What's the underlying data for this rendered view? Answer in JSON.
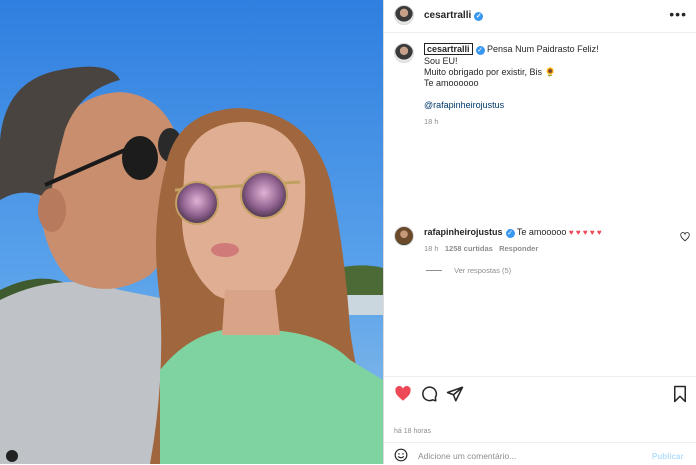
{
  "post": {
    "username": "cesartralli",
    "caption": {
      "first_line": "Pensa Num Paidrasto Feliz!",
      "line2": "Sou EU!",
      "line3": "Muito obrigado por existir, Bis",
      "line3_emoji": "🌻",
      "line4": "Te amoooooo",
      "mention": "@rafapinheirojustus",
      "time": "18 h"
    },
    "time_ago": "há 18 horas"
  },
  "comment": {
    "username": "rafapinheirojustus",
    "text": "Te amooooo",
    "hearts": "♥ ♥ ♥ ♥ ♥",
    "time": "18 h",
    "likes": "1258 curtidas",
    "reply": "Responder",
    "view_replies": "Ver respostas (5)"
  },
  "add_comment": {
    "placeholder": "Adicione um comentário...",
    "publish": "Publicar"
  },
  "colors": {
    "heart": "#ed4956",
    "verified": "#3897f0",
    "link": "#00376b"
  },
  "icons": [
    "more-icon",
    "heart-icon",
    "comment-icon",
    "share-icon",
    "bookmark-icon",
    "emoji-icon",
    "comment-like-icon"
  ]
}
